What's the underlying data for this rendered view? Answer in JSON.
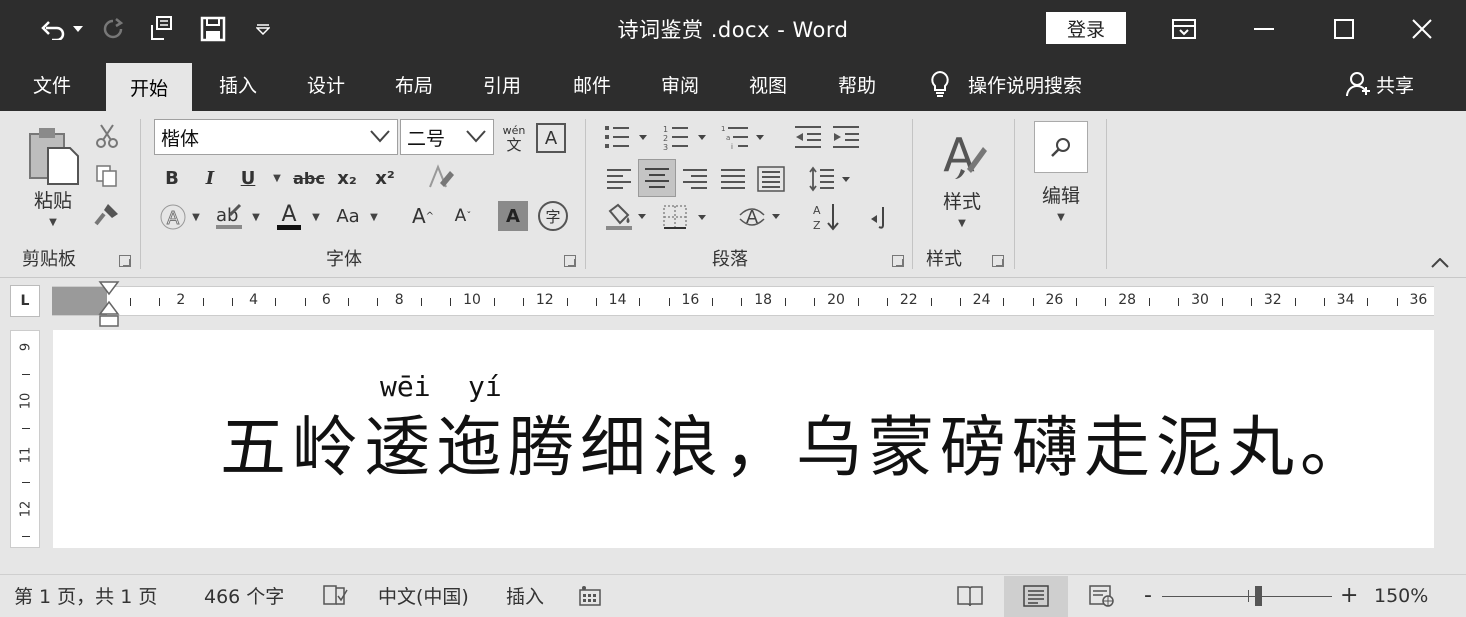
{
  "titlebar": {
    "doc_title": "诗词鉴赏 .docx - Word",
    "login_label": "登录",
    "icons": [
      "undo-icon",
      "undo-dropdown-icon",
      "redo-icon",
      "touch-mode-icon",
      "save-icon",
      "customize-qat-icon",
      "ribbon-display-options-icon",
      "minimize-icon",
      "maximize-icon",
      "close-icon"
    ]
  },
  "tabs": [
    {
      "label": "文件",
      "active": false
    },
    {
      "label": "开始",
      "active": true
    },
    {
      "label": "插入",
      "active": false
    },
    {
      "label": "设计",
      "active": false
    },
    {
      "label": "布局",
      "active": false
    },
    {
      "label": "引用",
      "active": false
    },
    {
      "label": "邮件",
      "active": false
    },
    {
      "label": "审阅",
      "active": false
    },
    {
      "label": "视图",
      "active": false
    },
    {
      "label": "帮助",
      "active": false
    }
  ],
  "tell_me": "操作说明搜索",
  "share_label": "共享",
  "ribbon": {
    "clipboard": {
      "paste_label": "粘贴",
      "group_label": "剪贴板"
    },
    "font": {
      "font_name": "楷体",
      "font_size": "二号",
      "group_label": "字体",
      "pinyin_guide_top": "wén",
      "pinyin_guide_bottom": "文",
      "bold": "B",
      "italic": "I",
      "underline": "U",
      "strikethrough": "abc",
      "subscript": "x₂",
      "superscript": "x²",
      "change_case": "Aa",
      "grow_font": "A",
      "shrink_font": "A",
      "char_shading": "A",
      "enclose_char": "字"
    },
    "paragraph": {
      "group_label": "段落"
    },
    "styles": {
      "label": "样式",
      "group_label": "样式"
    },
    "editing": {
      "label": "编辑"
    }
  },
  "ruler": {
    "marks": [
      "2",
      "4",
      "6",
      "8",
      "10",
      "12",
      "14",
      "16",
      "18",
      "20",
      "22",
      "24",
      "26",
      "28",
      "30",
      "32",
      "34",
      "36"
    ],
    "vertical_marks": [
      "9",
      "10",
      "11",
      "12"
    ],
    "tab_selector": "L"
  },
  "document": {
    "pinyin": [
      "wēi",
      "yí"
    ],
    "text": "五岭逶迤腾细浪，乌蒙磅礴走泥丸。"
  },
  "status": {
    "page_info": "第 1 页，共 1 页",
    "word_count": "466 个字",
    "language": "中文(中国)",
    "insert_mode": "插入",
    "zoom_minus": "-",
    "zoom_plus": "+",
    "zoom_level": "150%",
    "zoom_percent": 150
  }
}
